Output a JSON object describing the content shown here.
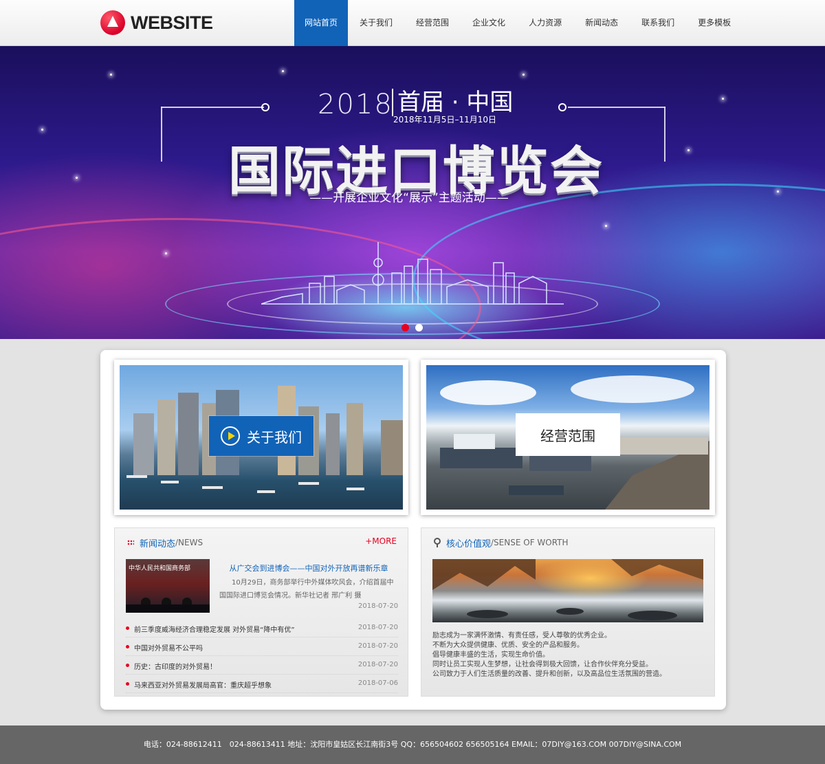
{
  "header": {
    "logo_text": "WEBSITE",
    "nav": [
      {
        "label": "网站首页",
        "active": true
      },
      {
        "label": "关于我们"
      },
      {
        "label": "经营范围"
      },
      {
        "label": "企业文化"
      },
      {
        "label": "人力资源"
      },
      {
        "label": "新闻动态"
      },
      {
        "label": "联系我们"
      },
      {
        "label": "更多模板"
      }
    ]
  },
  "banner": {
    "year": "2018",
    "edition": "首届 · 中国",
    "dates": "2018年11月5日–11月10日",
    "title": "国际进口博览会",
    "subtitle": "——开展企业文化“展示”主题活动——",
    "slides": 2,
    "active_slide": 0
  },
  "cards": {
    "about_label": "关于我们",
    "scope_label": "经营范围"
  },
  "news": {
    "title_cn": "新闻动态",
    "title_en": "/NEWS",
    "more": "+MORE",
    "thumb_caption": "中华人民共和国商务部",
    "featured": {
      "title": "从广交会到进博会——中国对外开放再谱新乐章",
      "summary": "10月29日，商务部举行中外媒体吹风会，介绍首届中国国际进口博览会情况。新华社记者 邢广利 摄",
      "date": "2018-07-20"
    },
    "items": [
      {
        "title": "前三季度威海经济合理稳定发展 对外贸易“降中有优”",
        "date": "2018-07-20"
      },
      {
        "title": "中国对外贸易不公平吗",
        "date": "2018-07-20"
      },
      {
        "title": "历史：古印度的对外贸易！",
        "date": "2018-07-20"
      },
      {
        "title": "马来西亚对外贸易发展局高官：重庆超乎想象",
        "date": "2018-07-06"
      }
    ]
  },
  "values": {
    "title_cn": "核心价值观",
    "title_en": "/SENSE OF WORTH",
    "lines": [
      "励志成为一家满怀激情、有责任感，受人尊敬的优秀企业。",
      "不断为大众提供健康、优质、安全的产品和服务。",
      "倡导健康丰盛的生活，实现生命价值。",
      "同时让员工实现人生梦想，让社会得到极大回馈，让合作伙伴充分受益。",
      "公司致力于人们生活质量的改善、提升和创新，以及高品位生活氛围的营造。"
    ]
  },
  "footer": {
    "text": "电话：024-88612411　024-88613411 地址：沈阳市皇姑区长江南街3号 QQ：656504602 656505164 EMAIL：07DIY@163.COM 007DIY@SINA.COM"
  },
  "colors": {
    "primary": "#1163b8",
    "accent": "#e8001f",
    "footer_bg": "#666666"
  }
}
